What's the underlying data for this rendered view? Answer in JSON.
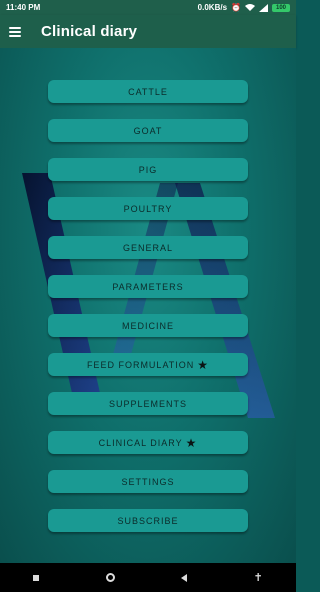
{
  "status_bar": {
    "time": "11:40 PM",
    "net_speed": "0.0KB/s",
    "icons": [
      "alarm-icon",
      "wifi-icon",
      "signal-icon"
    ],
    "battery": "100"
  },
  "app_bar": {
    "title": "Clinical diary"
  },
  "menu": {
    "items": [
      {
        "label": "CATTLE",
        "star": ""
      },
      {
        "label": "GOAT",
        "star": ""
      },
      {
        "label": "PIG",
        "star": ""
      },
      {
        "label": "POULTRY",
        "star": ""
      },
      {
        "label": "GENERAL",
        "star": ""
      },
      {
        "label": "PARAMETERS",
        "star": ""
      },
      {
        "label": "MEDICINE",
        "star": ""
      },
      {
        "label": "FEED FORMULATION",
        "star": "★"
      },
      {
        "label": "SUPPLEMENTS",
        "star": ""
      },
      {
        "label": "CLINICAL DIARY",
        "star": "★"
      },
      {
        "label": "SETTINGS",
        "star": ""
      },
      {
        "label": "SUBSCRIBE",
        "star": ""
      }
    ]
  },
  "nav_bar": {
    "icons": [
      "recents-icon",
      "home-icon",
      "back-icon",
      "accessibility-icon"
    ]
  },
  "colors": {
    "app_bar": "#1e5f4b",
    "menu_button": "#1a9a93",
    "background": "#0f6f6b"
  }
}
